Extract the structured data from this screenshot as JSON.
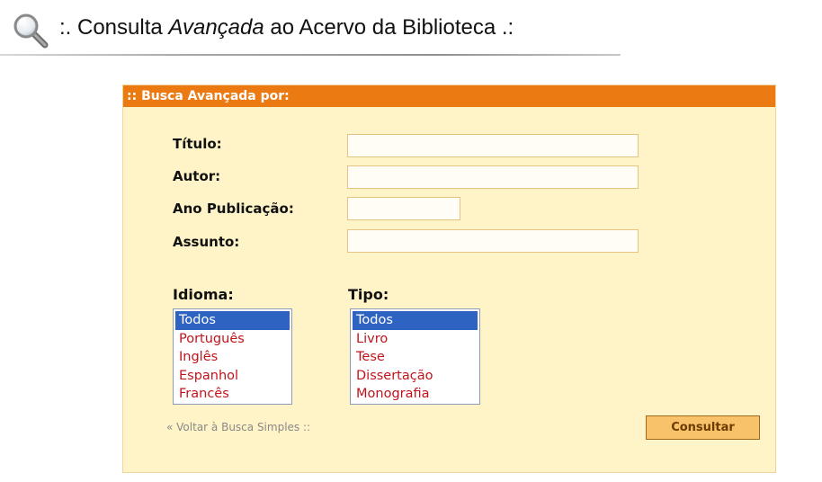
{
  "header": {
    "title_prefix": ":. Consulta ",
    "title_em": "Avançada",
    "title_suffix": " ao Acervo da Biblioteca .:",
    "icon": "magnifier-icon"
  },
  "panel": {
    "heading": ":: Busca Avançada por:",
    "fields": {
      "titulo": {
        "label": "Título:",
        "value": ""
      },
      "autor": {
        "label": "Autor:",
        "value": ""
      },
      "ano": {
        "label": "Ano Publicação:",
        "value": ""
      },
      "assunto": {
        "label": "Assunto:",
        "value": ""
      }
    },
    "idioma": {
      "label": "Idioma:",
      "options": [
        "Todos",
        "Português",
        "Inglês",
        "Espanhol",
        "Francês"
      ],
      "selected": "Todos"
    },
    "tipo": {
      "label": "Tipo:",
      "options": [
        "Todos",
        "Livro",
        "Tese",
        "Dissertação",
        "Monografia"
      ],
      "selected": "Todos"
    },
    "back_link": "« Voltar à Busca Simples ::",
    "submit_label": "Consultar"
  },
  "colors": {
    "panel_bg": "#fff4c7",
    "panel_header": "#ec7a12",
    "option_text": "#c0141c",
    "selected_bg": "#2f63c1",
    "button_bg": "#f7c26a"
  }
}
